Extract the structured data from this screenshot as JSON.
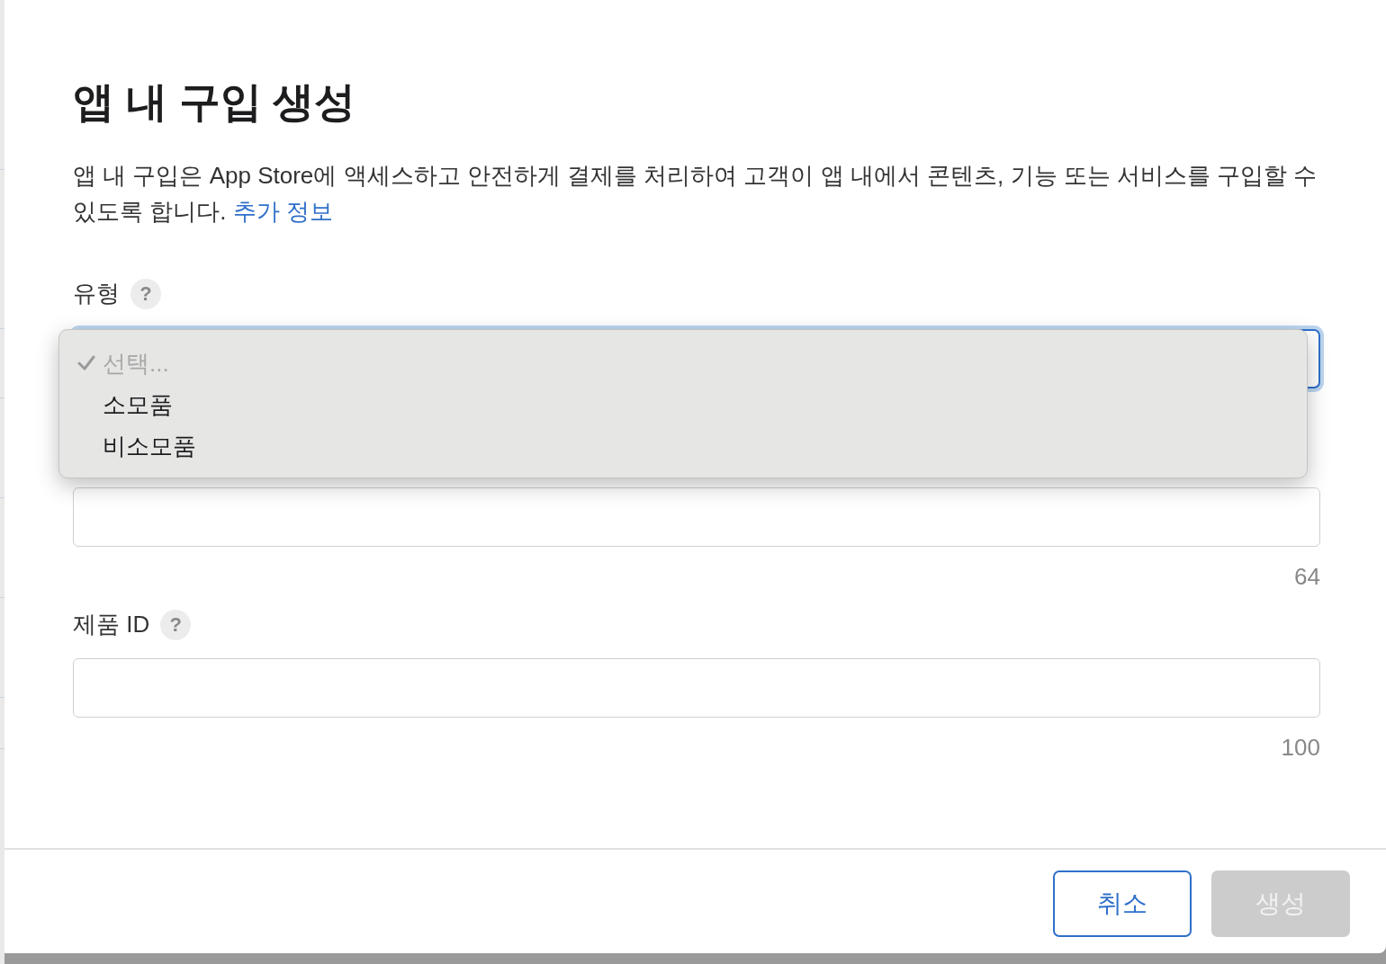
{
  "dialog": {
    "title": "앱 내 구입 생성",
    "description": "앱 내 구입은 App Store에 액세스하고 안전하게 결제를 처리하여 고객이 앱 내에서 콘텐츠, 기능 또는 서비스를 구입할 수 있도록 합니다.",
    "link": "추가 정보"
  },
  "type_field": {
    "label": "유형",
    "help": "?",
    "menu": [
      {
        "label": "선택...",
        "selected": true,
        "disabled": true
      },
      {
        "label": "소모품",
        "selected": false,
        "disabled": false
      },
      {
        "label": "비소모품",
        "selected": false,
        "disabled": false
      }
    ]
  },
  "name_field": {
    "counter": "64"
  },
  "product_id_field": {
    "label": "제품 ID",
    "help": "?",
    "counter": "100"
  },
  "buttons": [
    {
      "label": "취소",
      "kind": "secondary",
      "disabled": false
    },
    {
      "label": "생성",
      "kind": "primary",
      "disabled": true
    }
  ]
}
